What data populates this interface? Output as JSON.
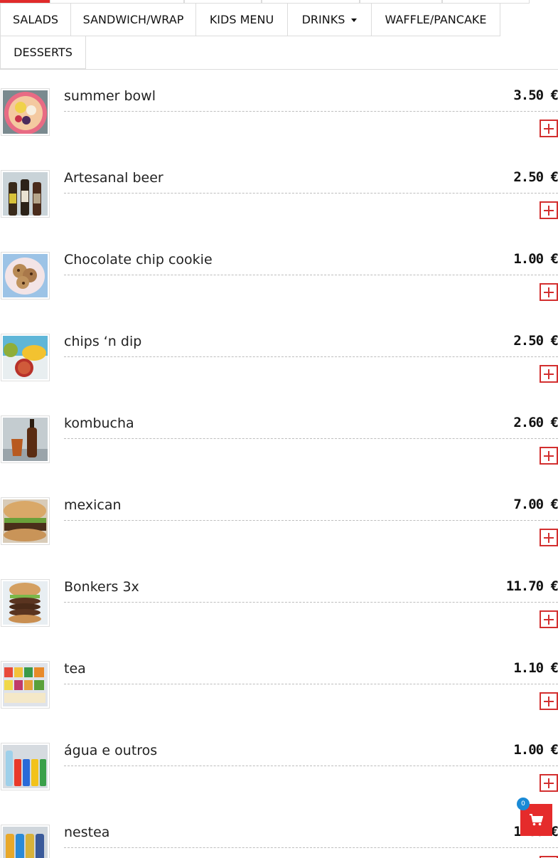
{
  "tabs": [
    {
      "label": "SALADS"
    },
    {
      "label": "SANDWICH/WRAP"
    },
    {
      "label": "KIDS MENU"
    },
    {
      "label": "DRINKS"
    },
    {
      "label": "WAFFLE/PANCAKE"
    },
    {
      "label": "DESSERTS"
    }
  ],
  "active_tab_color": "#e02b2b",
  "accent_color": "#d32f2f",
  "items": [
    {
      "name": "summer bowl",
      "price": "3.50 €",
      "image": "fruit-bowl-image"
    },
    {
      "name": "Artesanal beer",
      "price": "2.50 €",
      "image": "beer-bottles-image"
    },
    {
      "name": "Chocolate chip cookie",
      "price": "1.00 €",
      "image": "cookies-image"
    },
    {
      "name": "chips ‘n dip",
      "price": "2.50 €",
      "image": "chips-dip-image"
    },
    {
      "name": "kombucha",
      "price": "2.60 €",
      "image": "kombucha-image"
    },
    {
      "name": "mexican",
      "price": "7.00 €",
      "image": "burger-image"
    },
    {
      "name": "Bonkers 3x",
      "price": "11.70 €",
      "image": "triple-burger-image"
    },
    {
      "name": "tea",
      "price": "1.10 €",
      "image": "tea-boxes-image"
    },
    {
      "name": "água e outros",
      "price": "1.00 €",
      "image": "drinks-image"
    },
    {
      "name": "nestea",
      "price": "1.80 €",
      "image": "nestea-image"
    }
  ],
  "cart": {
    "count": "0",
    "icon": "shopping-cart-icon",
    "color": "#e52b2b",
    "badge_color": "#1a8ad6"
  }
}
